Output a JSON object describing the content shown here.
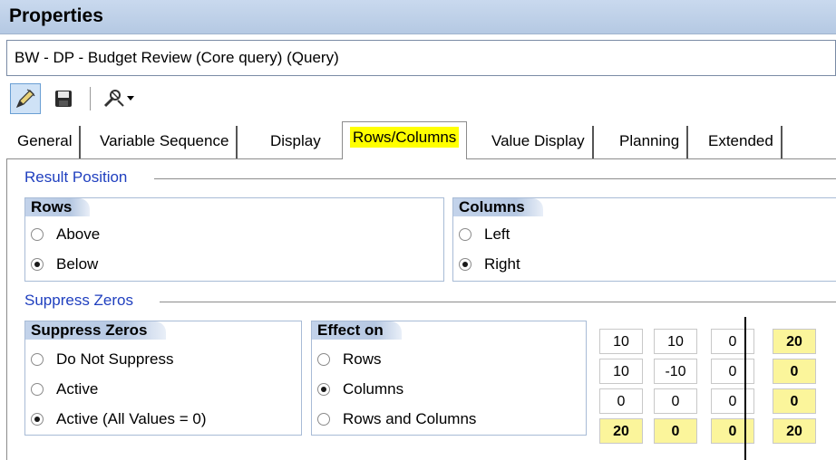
{
  "window": {
    "title": "Properties"
  },
  "query": {
    "name": "BW - DP - Budget Review (Core query) (Query)"
  },
  "toolbar": {
    "buttons": [
      "edit-icon",
      "save-icon",
      "tools-icon",
      "dropdown-arrow-icon"
    ]
  },
  "tabs": [
    {
      "label": "General"
    },
    {
      "label": "Variable Sequence"
    },
    {
      "label": "Display"
    },
    {
      "label": "Rows/Columns",
      "active": true
    },
    {
      "label": "Value Display"
    },
    {
      "label": "Planning"
    },
    {
      "label": "Extended"
    }
  ],
  "result_position": {
    "label": "Result Position",
    "rows": {
      "header": "Rows",
      "options": [
        "Above",
        "Below"
      ],
      "selected": "Below"
    },
    "columns": {
      "header": "Columns",
      "options": [
        "Left",
        "Right"
      ],
      "selected": "Right"
    }
  },
  "suppress_zeros": {
    "label": "Suppress Zeros",
    "mode": {
      "header": "Suppress Zeros",
      "options": [
        "Do Not Suppress",
        "Active",
        "Active (All Values = 0)"
      ],
      "selected": "Active (All Values = 0)"
    },
    "effect": {
      "header": "Effect on",
      "options": [
        "Rows",
        "Columns",
        "Rows and Columns"
      ],
      "selected": "Columns"
    }
  },
  "preview_grid": {
    "rows": [
      [
        "10",
        "10",
        "0",
        "20"
      ],
      [
        "10",
        "-10",
        "0",
        "0"
      ],
      [
        "0",
        "0",
        "0",
        "0"
      ],
      [
        "20",
        "0",
        "0",
        "20"
      ]
    ]
  },
  "colors": {
    "highlight": "#fbf59b",
    "tab_highlight": "#ffff00",
    "section_label": "#1f3fbf"
  }
}
